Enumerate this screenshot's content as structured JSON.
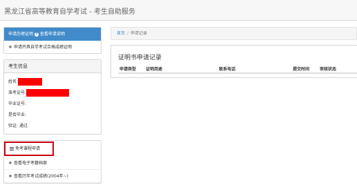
{
  "header": {
    "title": "黑龙江省高等教育自学考试 - 考生自助服务"
  },
  "sidebar": {
    "apply": {
      "title": "申请办理证明",
      "link": "查看申请说明",
      "item": "申请开具自学考试合格成绩证明"
    },
    "info": {
      "title": "考生信息",
      "rows": [
        {
          "label": "姓名:",
          "value": ""
        },
        {
          "label": "准考证号:",
          "value": ""
        },
        {
          "label": "毕业证号:",
          "value": ""
        },
        {
          "label": "是否毕业:",
          "value": ""
        },
        {
          "label": "验证:",
          "value": "通过"
        }
      ]
    },
    "menu": [
      {
        "label": "免考课程申请",
        "icon": "list-icon"
      },
      {
        "label": "查看电子考籍档案",
        "icon": "plus-icon"
      },
      {
        "label": "查看历年考试成绩(2004年~)",
        "icon": "plus-icon"
      }
    ]
  },
  "breadcrumb": {
    "home": "首页",
    "separator": "/",
    "current": "申请记录"
  },
  "records": {
    "title": "证明书申请记录",
    "columns": [
      "申请类型",
      "证明用途",
      "联系电话",
      "提交时间",
      "审核状态"
    ]
  },
  "colors": {
    "accent": "#428bca",
    "highlight_border": "#c8000f",
    "redaction": "#ff0000"
  }
}
